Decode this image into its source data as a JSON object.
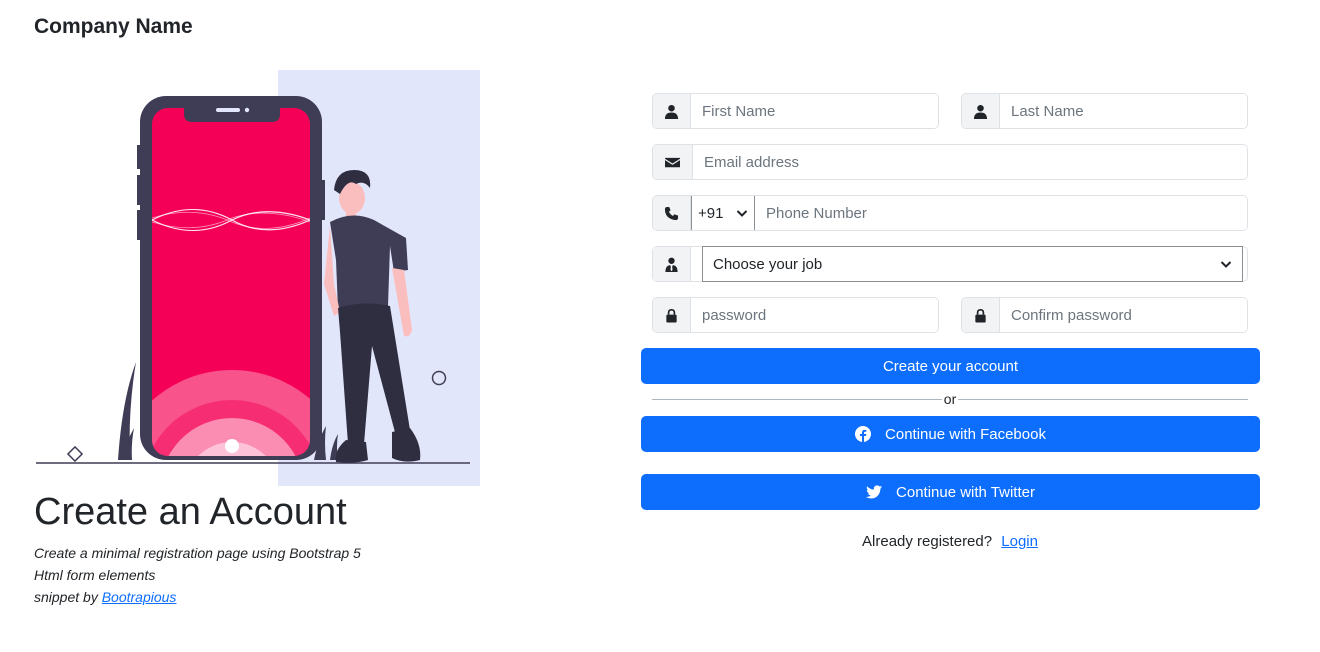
{
  "brand": {
    "name": "Company Name"
  },
  "hero": {
    "title": "Create an Account",
    "line1": "Create a minimal registration page using Bootstrap 5",
    "line2": "Html form elements",
    "line3_prefix": "snippet by",
    "line3_link": "Bootrapious"
  },
  "form": {
    "first_name_placeholder": "First Name",
    "last_name_placeholder": "Last Name",
    "email_placeholder": "Email address",
    "country_code": "+91",
    "phone_placeholder": "Phone Number",
    "job_selected": "Choose your job",
    "password_placeholder": "password",
    "confirm_password_placeholder": "Confirm password",
    "create_button": "Create your account",
    "divider_text": "or",
    "facebook_button": "Continue with Facebook",
    "twitter_button": "Continue with Twitter",
    "login_prompt": "Already registered?",
    "login_link": "Login"
  },
  "icons": {
    "first_name": "user-icon",
    "last_name": "user-icon",
    "email": "envelope-icon",
    "phone": "phone-icon",
    "job": "user-tie-icon",
    "password": "lock-icon",
    "confirm_password": "lock-icon",
    "facebook": "facebook-icon",
    "twitter": "twitter-icon"
  },
  "colors": {
    "primary": "#0d6efd",
    "phone_screen": "#f50057",
    "illustration_dark": "#3f3d56",
    "illustration_bg": "#e2e6fb"
  }
}
